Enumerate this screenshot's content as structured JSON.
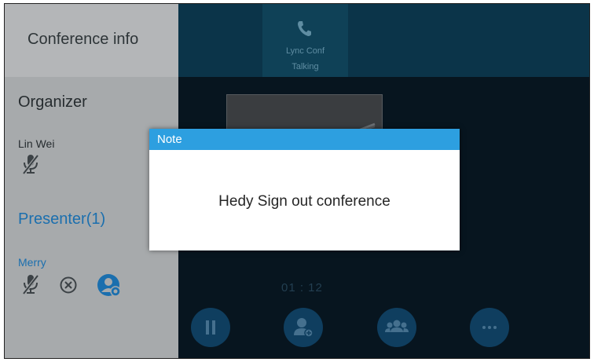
{
  "left_panel": {
    "title": "Conference info",
    "organizer": {
      "heading": "Organizer",
      "name": "Lin Wei",
      "icons": [
        "microphone-muted-icon"
      ]
    },
    "presenters": {
      "heading": "Presenter(1)",
      "members": [
        {
          "name": "Merry",
          "icons": [
            "microphone-muted-icon",
            "remove-circle-icon",
            "presenter-role-icon"
          ]
        }
      ]
    }
  },
  "call_tab": {
    "icon": "phone-icon",
    "name": "Lync Conf",
    "status": "Talking"
  },
  "call": {
    "timer": "01 : 12"
  },
  "controls": [
    {
      "icon": "pause-icon"
    },
    {
      "icon": "add-participant-icon"
    },
    {
      "icon": "participants-icon"
    },
    {
      "icon": "more-icon"
    }
  ],
  "dialog": {
    "title": "Note",
    "message": "Hedy Sign out conference"
  },
  "colors": {
    "panel": "#a7aaac",
    "top_bar": "#0b3449",
    "accent": "#2d9fe0",
    "presenter_text": "#1b6fae",
    "control_button": "#0f3e5f"
  }
}
